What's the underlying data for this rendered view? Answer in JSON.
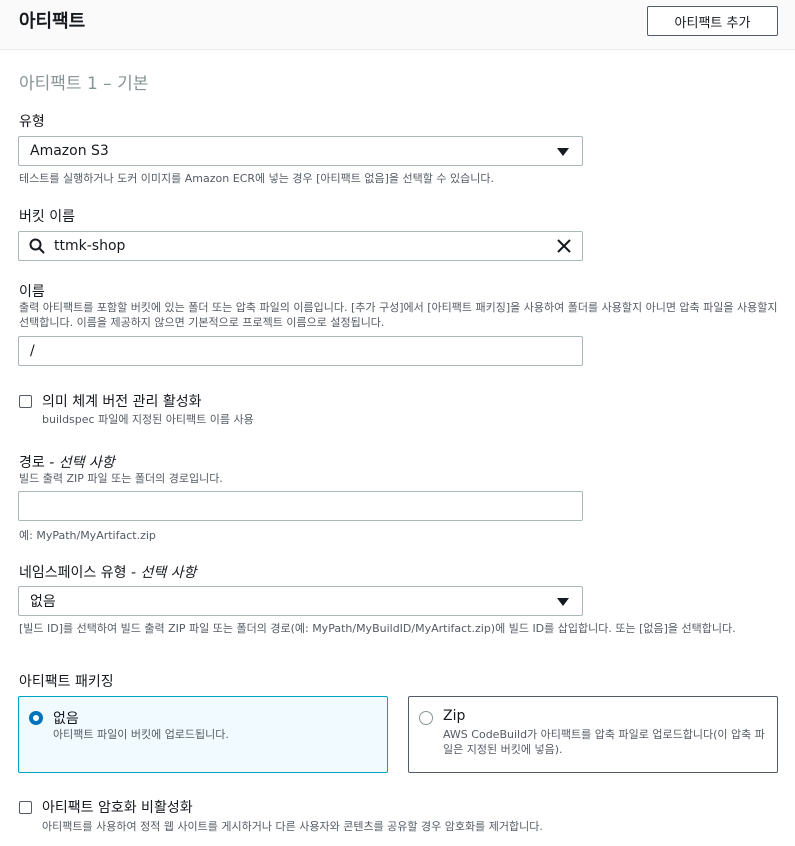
{
  "header": {
    "title": "아티팩트",
    "add_label": "아티팩트 추가"
  },
  "section": {
    "title": "아티팩트 1 – 기본"
  },
  "type_field": {
    "label": "유형",
    "value": "Amazon S3",
    "description": "테스트를 실행하거나 도커 이미지를 Amazon ECR에 넣는 경우 [아티팩트 없음]을 선택할 수 있습니다."
  },
  "bucket_field": {
    "label": "버킷 이름",
    "value": "ttmk-shop"
  },
  "name_field": {
    "label": "이름",
    "description": "출력 아티팩트를 포함할 버킷에 있는 폴더 또는 압축 파일의 이름입니다. [추가 구성]에서 [아티팩트 패키징]을 사용하여 폴더를 사용할지 아니면 압축 파일을 사용할지 선택합니다. 이름을 제공하지 않으면 기본적으로 프로젝트 이름으로 설정됩니다.",
    "value": "/"
  },
  "semantic_versioning": {
    "label": "의미 체계 버전 관리 활성화",
    "description": "buildspec 파일에 지정된 아티팩트 이름 사용",
    "checked": false
  },
  "path_field": {
    "label": "경로 - ",
    "optional": "선택 사항",
    "description": "빌드 출력 ZIP 파일 또는 폴더의 경로입니다.",
    "value": "",
    "example": "예: MyPath/MyArtifact.zip"
  },
  "namespace_field": {
    "label": "네임스페이스 유형 - ",
    "optional": "선택 사항",
    "value": "없음",
    "description": "[빌드 ID]를 선택하여 빌드 출력 ZIP 파일 또는 폴더의 경로(예: MyPath/MyBuildID/MyArtifact.zip)에 빌드 ID를 삽입합니다. 또는 [없음]을 선택합니다."
  },
  "packaging": {
    "label": "아티팩트 패키징",
    "options": [
      {
        "title": "없음",
        "description": "아티팩트 파일이 버킷에 업로드됩니다.",
        "selected": true
      },
      {
        "title": "Zip",
        "description": "AWS CodeBuild가 아티팩트를 압축 파일로 업로드합니다(이 압축 파일은 지정된 버킷에 넣음).",
        "selected": false
      }
    ]
  },
  "encryption": {
    "label": "아티팩트 암호화 비활성화",
    "description": "아티팩트를 사용하여 정적 웹 사이트를 게시하거나 다른 사용자와 콘텐츠를 공유할 경우 암호화를 제거합니다.",
    "checked": false
  },
  "icons": {
    "search": "search-icon",
    "clear": "close-icon",
    "dropdown": "caret-down-icon"
  },
  "colors": {
    "accent": "#0073bb",
    "selected_border": "#00a1c9",
    "selected_bg": "#f1faff"
  }
}
